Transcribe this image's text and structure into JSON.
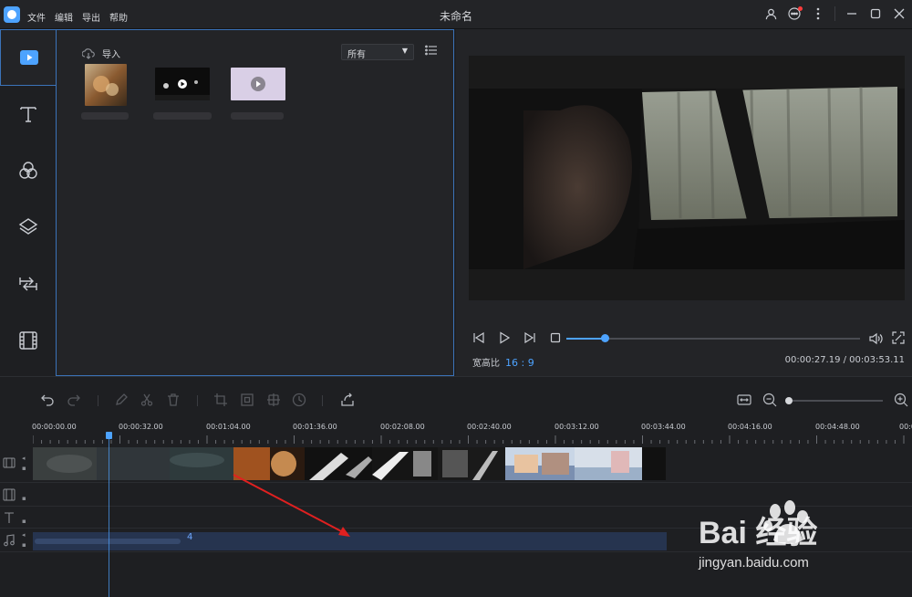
{
  "titlebar": {
    "menu": [
      "文件",
      "编辑",
      "导出",
      "帮助"
    ],
    "title": "未命名",
    "controls": [
      "user-icon",
      "message-icon",
      "more-icon",
      "minimize-icon",
      "maximize-icon",
      "close-icon"
    ]
  },
  "sidebar": {
    "items": [
      "media-icon",
      "text-icon",
      "filter-icon",
      "overlay-icon",
      "transition-icon",
      "element-icon"
    ],
    "active": 0
  },
  "library": {
    "import_label": "导入",
    "filter_value": "所有",
    "thumbnails": [
      "photo-thumbnail",
      "night-video-thumbnail",
      "video-thumbnail"
    ]
  },
  "preview": {
    "ratio_label": "宽高比",
    "ratio_value": "16 : 9",
    "timecode": "00:00:27.19 / 00:03:53.11",
    "progress": 0.13
  },
  "timeline": {
    "ruler_labels": [
      "00:00:00.00",
      "00:00:32.00",
      "00:01:04.00",
      "00:01:36.00",
      "00:02:08.00",
      "00:02:40.00",
      "00:03:12.00",
      "00:03:44.00",
      "00:04:16.00",
      "00:04:48.00",
      "00:0"
    ],
    "tracks": [
      "video-track",
      "overlay-track",
      "text-track",
      "audio-track"
    ],
    "audio_clip_suffix": "4"
  },
  "watermark": {
    "brand": "Bai 经验",
    "url": "jingyan.baidu.com"
  },
  "colors": {
    "accent": "#4da3ff",
    "annotation_arrow": "#e02020",
    "background": "#1e1f22"
  }
}
